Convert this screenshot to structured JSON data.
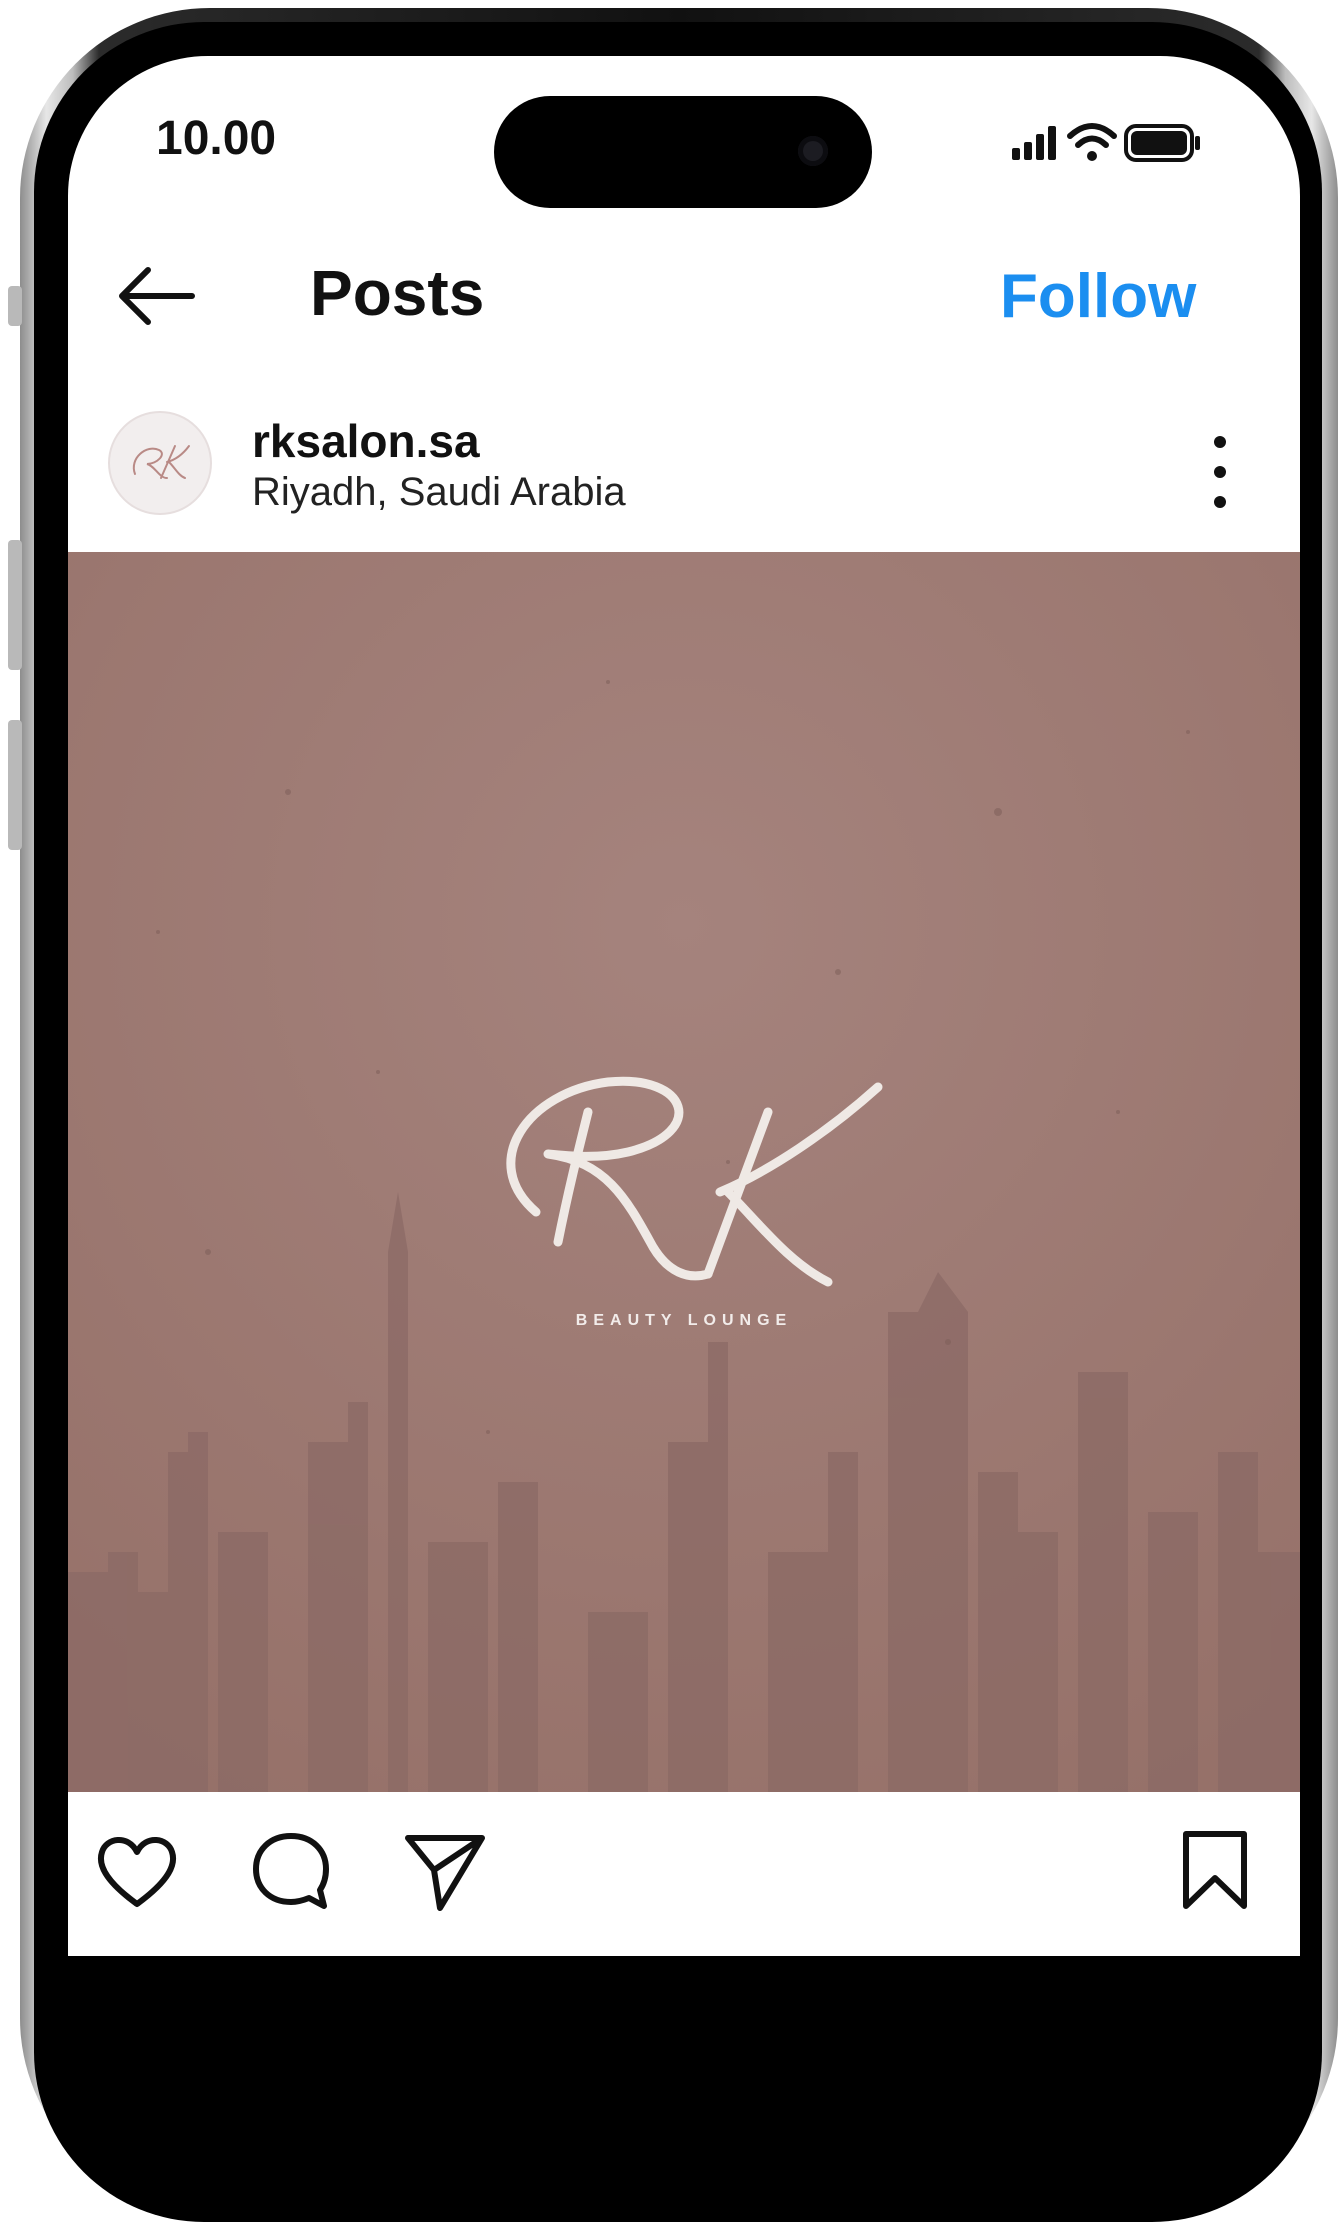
{
  "status_bar": {
    "time": "10.00"
  },
  "header": {
    "title": "Posts",
    "follow_label": "Follow"
  },
  "post": {
    "username": "rksalon.sa",
    "location": "Riyadh, Saudi Arabia",
    "brand_tagline": "BEAUTY LOUNGE"
  },
  "colors": {
    "follow_blue": "#1b8ef0",
    "post_background": "#9d7a74",
    "logo_ink": "#efe9e5"
  },
  "icons": [
    "back-arrow-icon",
    "more-options-icon",
    "like-icon",
    "comment-icon",
    "share-icon",
    "bookmark-icon"
  ]
}
